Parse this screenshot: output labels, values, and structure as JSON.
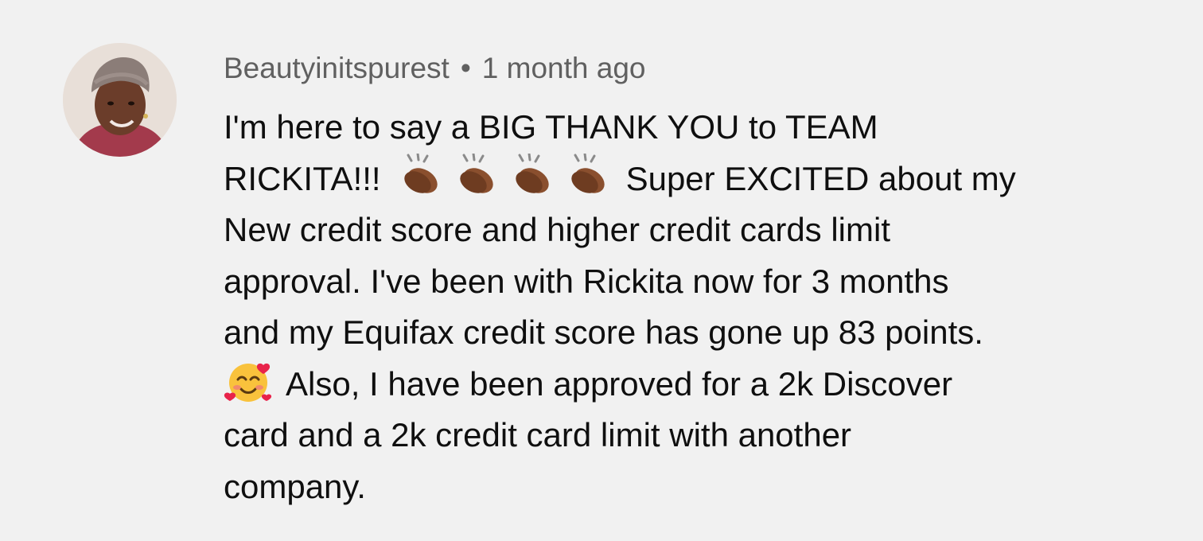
{
  "comment": {
    "author": "Beautyinitspurest",
    "separator": "•",
    "timestamp": "1 month ago",
    "lines": {
      "l1": "I'm here to say a BIG THANK YOU to TEAM",
      "l2a": "RICKITA!!!",
      "l2b": "Super EXCITED about my",
      "l3": "New credit score and higher credit cards limit",
      "l4": "approval. I've been with Rickita now for 3 months",
      "l5": "and my Equifax credit score has gone up 83 points.",
      "l6b": "Also, I have been approved for a 2k Discover",
      "l7": "card and a 2k credit card limit with another",
      "l8": "company."
    },
    "emojis": {
      "clap": "clapping-hands-medium-dark-skin",
      "clap_count": 4,
      "smile": "smiling-face-with-hearts"
    }
  }
}
